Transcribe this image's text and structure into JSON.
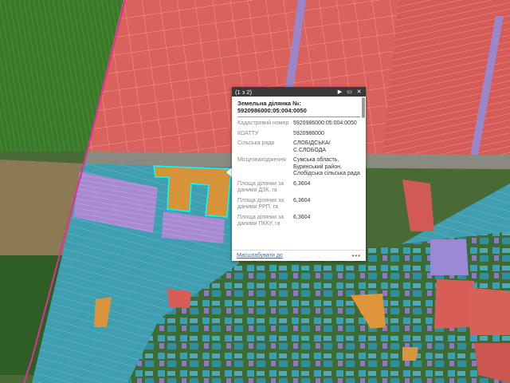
{
  "popup": {
    "count": "(1 з 2)",
    "title": "Земельна ділянка №: 5920986000:05:004:0050",
    "rows": [
      {
        "label": "Кадастровий номер",
        "value": "5920986000:05:004:0050"
      },
      {
        "label": "КОАТТУ",
        "value": "5920986000"
      },
      {
        "label": "Сільська рада",
        "value": "СЛОБІДСЬКА/ С.СЛОБОДА"
      },
      {
        "label": "Місцезнаходження",
        "value": "Сумська область, Буринський район, Слобідська сільська рада"
      },
      {
        "label": "Площа ділянки за даними ДЗК, га",
        "value": "6,3604"
      },
      {
        "label": "Площа ділянки за даними РРП, га",
        "value": "6,3604"
      },
      {
        "label": "Площа ділянки за даними ПККУ, га",
        "value": "6,3604"
      }
    ],
    "zoom_link": "Масштабувати до",
    "more": "•••",
    "icons": {
      "next": "play-icon",
      "maximize": "maximize-icon",
      "close": "close-icon"
    }
  },
  "colors": {
    "parcel_red": "#e0605a",
    "parcel_teal": "#3aa5b5",
    "parcel_purple": "#a98fd6",
    "parcel_orange": "#e09a3a",
    "boundary_pink": "#e0309a",
    "highlight": "#00ffff"
  }
}
